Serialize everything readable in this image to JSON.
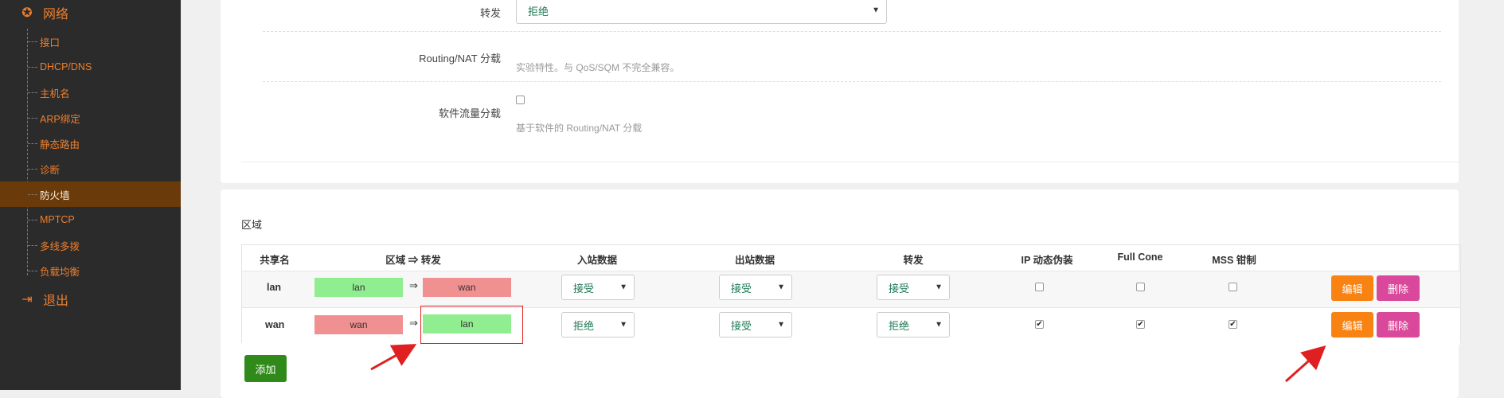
{
  "sidebar": {
    "network": {
      "label": "网络",
      "icon": "globe-icon"
    },
    "items": [
      {
        "label": "接口"
      },
      {
        "label": "DHCP/DNS"
      },
      {
        "label": "主机名"
      },
      {
        "label": "ARP绑定"
      },
      {
        "label": "静态路由"
      },
      {
        "label": "诊断"
      },
      {
        "label": "防火墙",
        "active": true
      },
      {
        "label": "MPTCP"
      },
      {
        "label": "多线多拨"
      },
      {
        "label": "负载均衡"
      }
    ],
    "logout": {
      "label": "退出",
      "icon": "logout-icon"
    }
  },
  "general": {
    "forward": {
      "label": "转发",
      "value": "拒绝"
    },
    "routing_nat": {
      "label": "Routing/NAT 分载",
      "help": "实验特性。与 QoS/SQM 不完全兼容。"
    },
    "soft_offload": {
      "label": "软件流量分载",
      "help": "基于软件的 Routing/NAT 分载",
      "checked": false
    }
  },
  "zones": {
    "title": "区域",
    "headers": {
      "name": "共享名",
      "zone_forward": "区域 ⇒ 转发",
      "input": "入站数据",
      "output": "出站数据",
      "forward": "转发",
      "masq": "IP 动态伪装",
      "fullcone": "Full Cone",
      "mss": "MSS 钳制"
    },
    "rows": [
      {
        "name": "lan",
        "zone": "lan",
        "zone_color": "#90ee90",
        "dest": "wan",
        "dest_color": "#f09090",
        "input": "接受",
        "output": "接受",
        "forward": "接受",
        "masq": false,
        "fullcone": false,
        "mss": false,
        "edit": "编辑",
        "delete": "删除"
      },
      {
        "name": "wan",
        "zone": "wan",
        "zone_color": "#f09090",
        "dest": "lan",
        "dest_color": "#90ee90",
        "input": "拒绝",
        "output": "接受",
        "forward": "拒绝",
        "masq": true,
        "fullcone": true,
        "mss": true,
        "edit": "编辑",
        "delete": "删除"
      }
    ],
    "arrow": "⇒",
    "add": "添加"
  },
  "colors": {
    "accent": "#ee7f2d",
    "sidebar_bg": "#2b2b2b",
    "edit": "#f88212",
    "delete": "#d9489b",
    "add": "#2f8a1a"
  }
}
